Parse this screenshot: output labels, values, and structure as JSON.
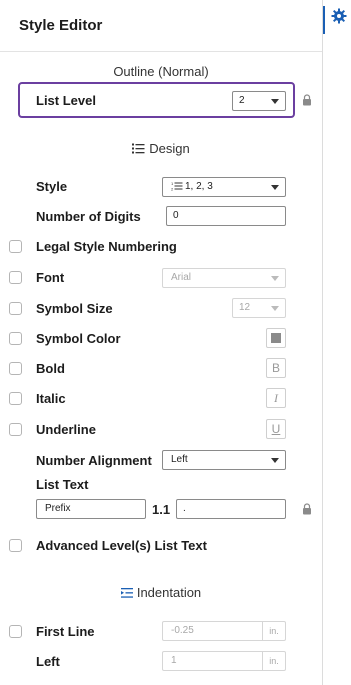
{
  "title": "Style Editor",
  "outline_heading": "Outline (Normal)",
  "list_level": {
    "label": "List Level",
    "value": "2"
  },
  "design": {
    "heading": "Design",
    "style_label": "Style",
    "style_value": "1, 2, 3",
    "num_digits_label": "Number of Digits",
    "num_digits_value": "0",
    "legal_label": "Legal Style Numbering",
    "font_label": "Font",
    "font_value": "Arial",
    "symbol_size_label": "Symbol Size",
    "symbol_size_value": "12",
    "symbol_color_label": "Symbol Color",
    "symbol_color": "#8a8a8a",
    "bold_label": "Bold",
    "bold_glyph": "B",
    "italic_label": "Italic",
    "italic_glyph": "I",
    "underline_label": "Underline",
    "underline_glyph": "U",
    "alignment_label": "Number Alignment",
    "alignment_value": "Left",
    "list_text_label": "List Text",
    "prefix_placeholder": "Prefix",
    "list_number": "1.1",
    "suffix_value": ".",
    "advanced_label": "Advanced Level(s) List Text"
  },
  "indentation": {
    "heading": "Indentation",
    "first_line_label": "First Line",
    "first_line_value": "-0.25",
    "first_line_unit": "in.",
    "left_label": "Left",
    "left_value": "1",
    "left_unit": "in."
  },
  "colors": {
    "accent": "#6b3fa0",
    "rail_marker": "#1a5fb4"
  }
}
